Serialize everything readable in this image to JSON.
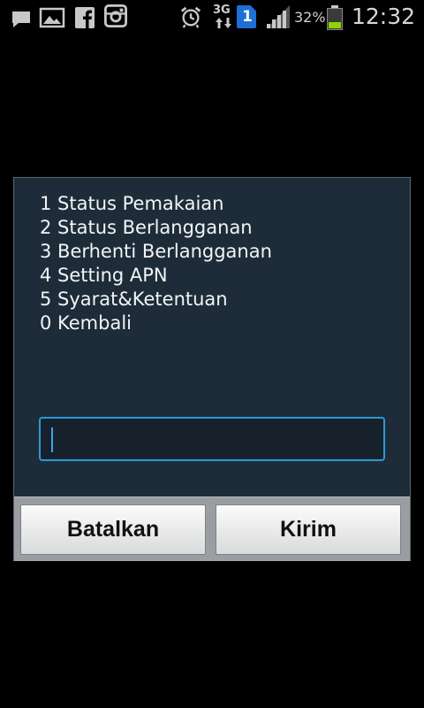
{
  "status_bar": {
    "left_icons": [
      "message-icon",
      "gallery-icon",
      "facebook-icon",
      "instagram-icon"
    ],
    "right_icons": [
      "alarm-icon",
      "network-3g-icon",
      "sim-1-icon",
      "signal-icon",
      "battery-icon"
    ],
    "network_label": "3G",
    "sim_label": "1",
    "battery_percent": "32%",
    "battery_level": 0.32,
    "time": "12:32"
  },
  "dialog": {
    "menu_lines": [
      "1 Status Pemakaian",
      "2 Status Berlangganan",
      "3 Berhenti Berlangganan",
      "4 Setting APN",
      "5 Syarat&Ketentuan",
      "0 Kembali"
    ],
    "input_value": "",
    "cancel_label": "Batalkan",
    "send_label": "Kirim"
  },
  "colors": {
    "dialog_bg": "#1e2c39",
    "input_border": "#2a9ad6",
    "battery_fill": "#8fd400"
  }
}
